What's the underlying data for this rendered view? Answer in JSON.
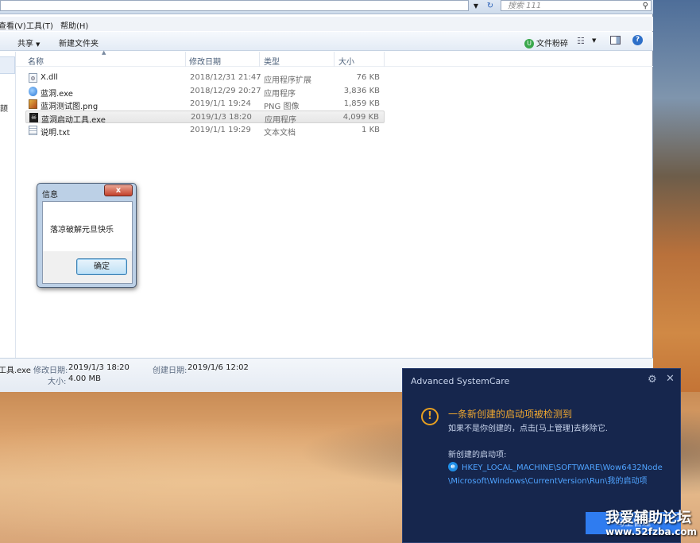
{
  "address_bar": {
    "search_placeholder": "搜索 111"
  },
  "menu": {
    "items": [
      "查看(V)",
      "工具(T)",
      "帮助(H)"
    ]
  },
  "toolbar": {
    "share": "共享",
    "new_folder": "新建文件夹",
    "shred": "文件粉碎"
  },
  "columns": {
    "name": "名称",
    "date": "修改日期",
    "type": "类型",
    "size": "大小"
  },
  "files": [
    {
      "name": "X.dll",
      "date": "2018/12/31 21:47",
      "type": "应用程序扩展",
      "size": "76 KB",
      "icon": "dll-file-icon"
    },
    {
      "name": "蓝洞.exe",
      "date": "2018/12/29 20:27",
      "type": "应用程序",
      "size": "3,836 KB",
      "icon": "exe-file-icon"
    },
    {
      "name": "蓝洞测试图.png",
      "date": "2019/1/1 19:24",
      "type": "PNG 图像",
      "size": "1,859 KB",
      "icon": "image-file-icon"
    },
    {
      "name": "蓝洞启动工具.exe",
      "date": "2019/1/3 18:20",
      "type": "应用程序",
      "size": "4,099 KB",
      "icon": "exe-file-icon"
    },
    {
      "name": "说明.txt",
      "date": "2019/1/1 19:29",
      "type": "文本文档",
      "size": "1 KB",
      "icon": "text-file-icon"
    }
  ],
  "nav_fragment": "颉",
  "details": {
    "filename": "工具.exe",
    "modified_label": "修改日期:",
    "modified": "2019/1/3 18:20",
    "created_label": "创建日期:",
    "created": "2019/1/6 12:02",
    "size_label": "大小:",
    "size": "4.00 MB"
  },
  "message_box": {
    "title": "信息",
    "close": "x",
    "text": "落凉破解元旦快乐",
    "ok": "确定"
  },
  "asc_popup": {
    "title": "Advanced SystemCare",
    "heading": "一条新创建的启动项被检测到",
    "subtext": "如果不是你创建的，点击[马上管理]去移除它.",
    "label": "新创建的启动项:",
    "path": "HKEY_LOCAL_MACHINE\\SOFTWARE\\Wow6432Node\\Microsoft\\Windows\\CurrentVersion\\Run\\我的启动项",
    "button": "马上管理"
  },
  "watermark": {
    "line1": "我爱辅助论坛",
    "line2": "www.52fzba.com"
  }
}
